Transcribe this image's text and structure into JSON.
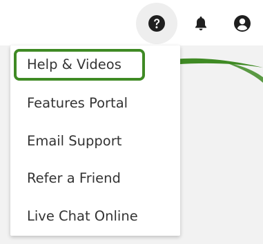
{
  "header": {
    "icons": [
      "help-icon",
      "bell-icon",
      "user-icon"
    ]
  },
  "menu": {
    "items": [
      {
        "label": "Help & Videos"
      },
      {
        "label": "Features Portal"
      },
      {
        "label": "Email Support"
      },
      {
        "label": "Refer a Friend"
      },
      {
        "label": "Live Chat Online"
      }
    ]
  },
  "annotation": {
    "highlight_color": "#3f8a24",
    "highlighted_item": "Help & Videos"
  }
}
